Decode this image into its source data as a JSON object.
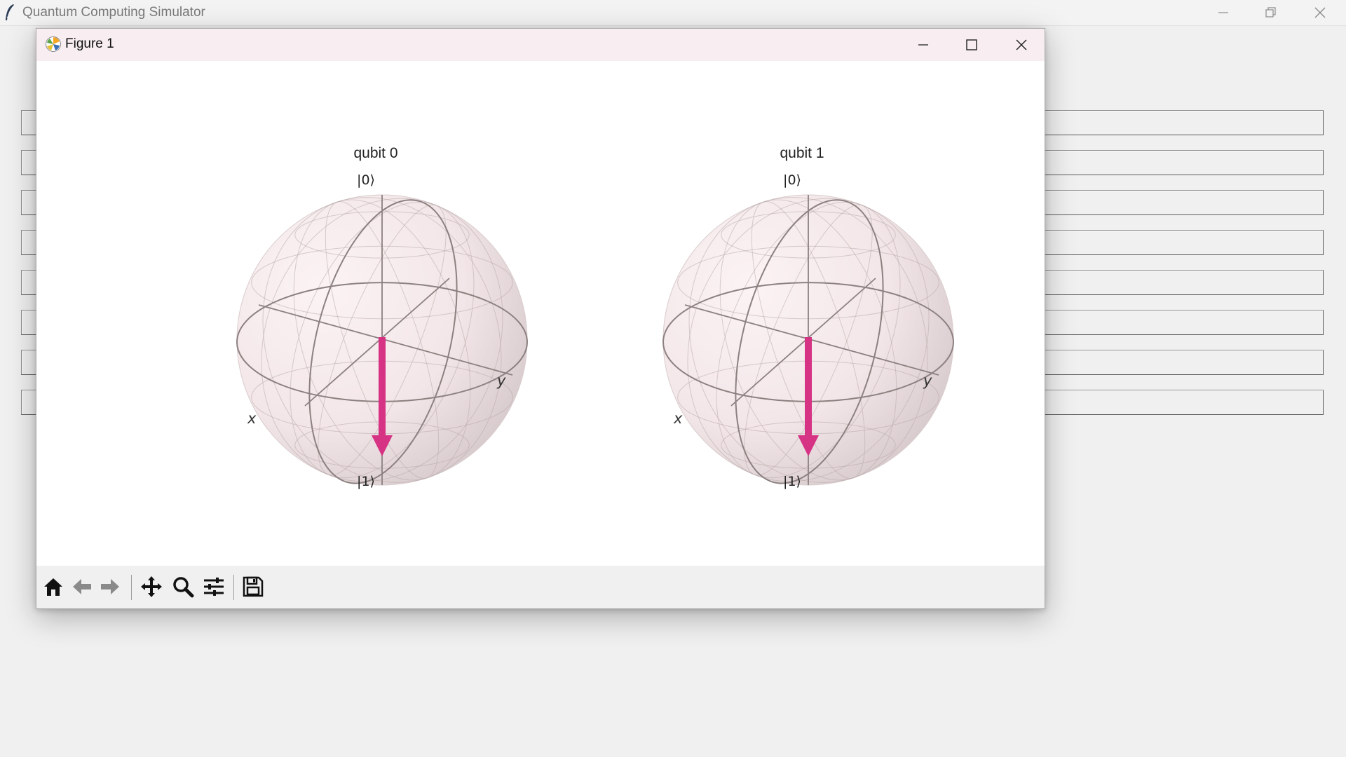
{
  "app": {
    "title": "Quantum Computing Simulator"
  },
  "figure_window": {
    "title": "Figure 1",
    "panels": [
      {
        "title": "qubit 0",
        "ket_top": "|0⟩",
        "ket_bottom": "|1⟩",
        "x_label": "x",
        "y_label": "y",
        "state_vector": "down"
      },
      {
        "title": "qubit 1",
        "ket_top": "|0⟩",
        "ket_bottom": "|1⟩",
        "x_label": "x",
        "y_label": "y",
        "state_vector": "down"
      }
    ],
    "toolbar": [
      "home-icon",
      "back-arrow-icon",
      "forward-arrow-icon",
      "pan-icon",
      "zoom-icon",
      "configure-subplots-icon",
      "save-icon"
    ]
  },
  "colors": {
    "vector": "#d63384",
    "sphere_fill": "#f3e6e8",
    "wireframe": "#8c8080"
  }
}
